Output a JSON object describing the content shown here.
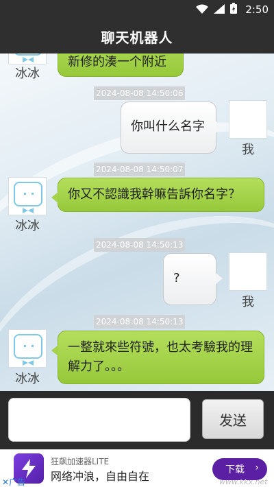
{
  "status_bar": {
    "time": "2:50"
  },
  "app_bar": {
    "title": "聊天机器人"
  },
  "messages": [
    {
      "side": "left",
      "text": "新修的湊一个附近",
      "name": "冰冰"
    },
    {
      "timestamp": "2024-08-08 14:50:06",
      "side": "right",
      "text": "你叫什么名字",
      "name": "我"
    },
    {
      "timestamp": "2024-08-08 14:50:07",
      "side": "left",
      "text": "你又不認識我幹嘛告訴你名字？",
      "name": "冰冰"
    },
    {
      "timestamp": "2024-08-08 14:50:13",
      "side": "right",
      "text": "?",
      "name": "我"
    },
    {
      "timestamp": "2024-08-08 14:50:13",
      "side": "left",
      "text": "一整就來些符號，也太考驗我的理解力了。。。",
      "name": "冰冰"
    }
  ],
  "input": {
    "value": "",
    "placeholder": ""
  },
  "send_label": "发送",
  "ad": {
    "app_name": "狂飙加速器LITE",
    "slogan": "网络冲浪，自由自在",
    "download_label": "下载",
    "ad_label": "广告",
    "watermark": "www.kkx.net",
    "accent": "#5a1fa3"
  },
  "colors": {
    "bot_bubble": "#a4d24a",
    "user_bubble": "#ffffff",
    "header": "#2f2f2f"
  }
}
